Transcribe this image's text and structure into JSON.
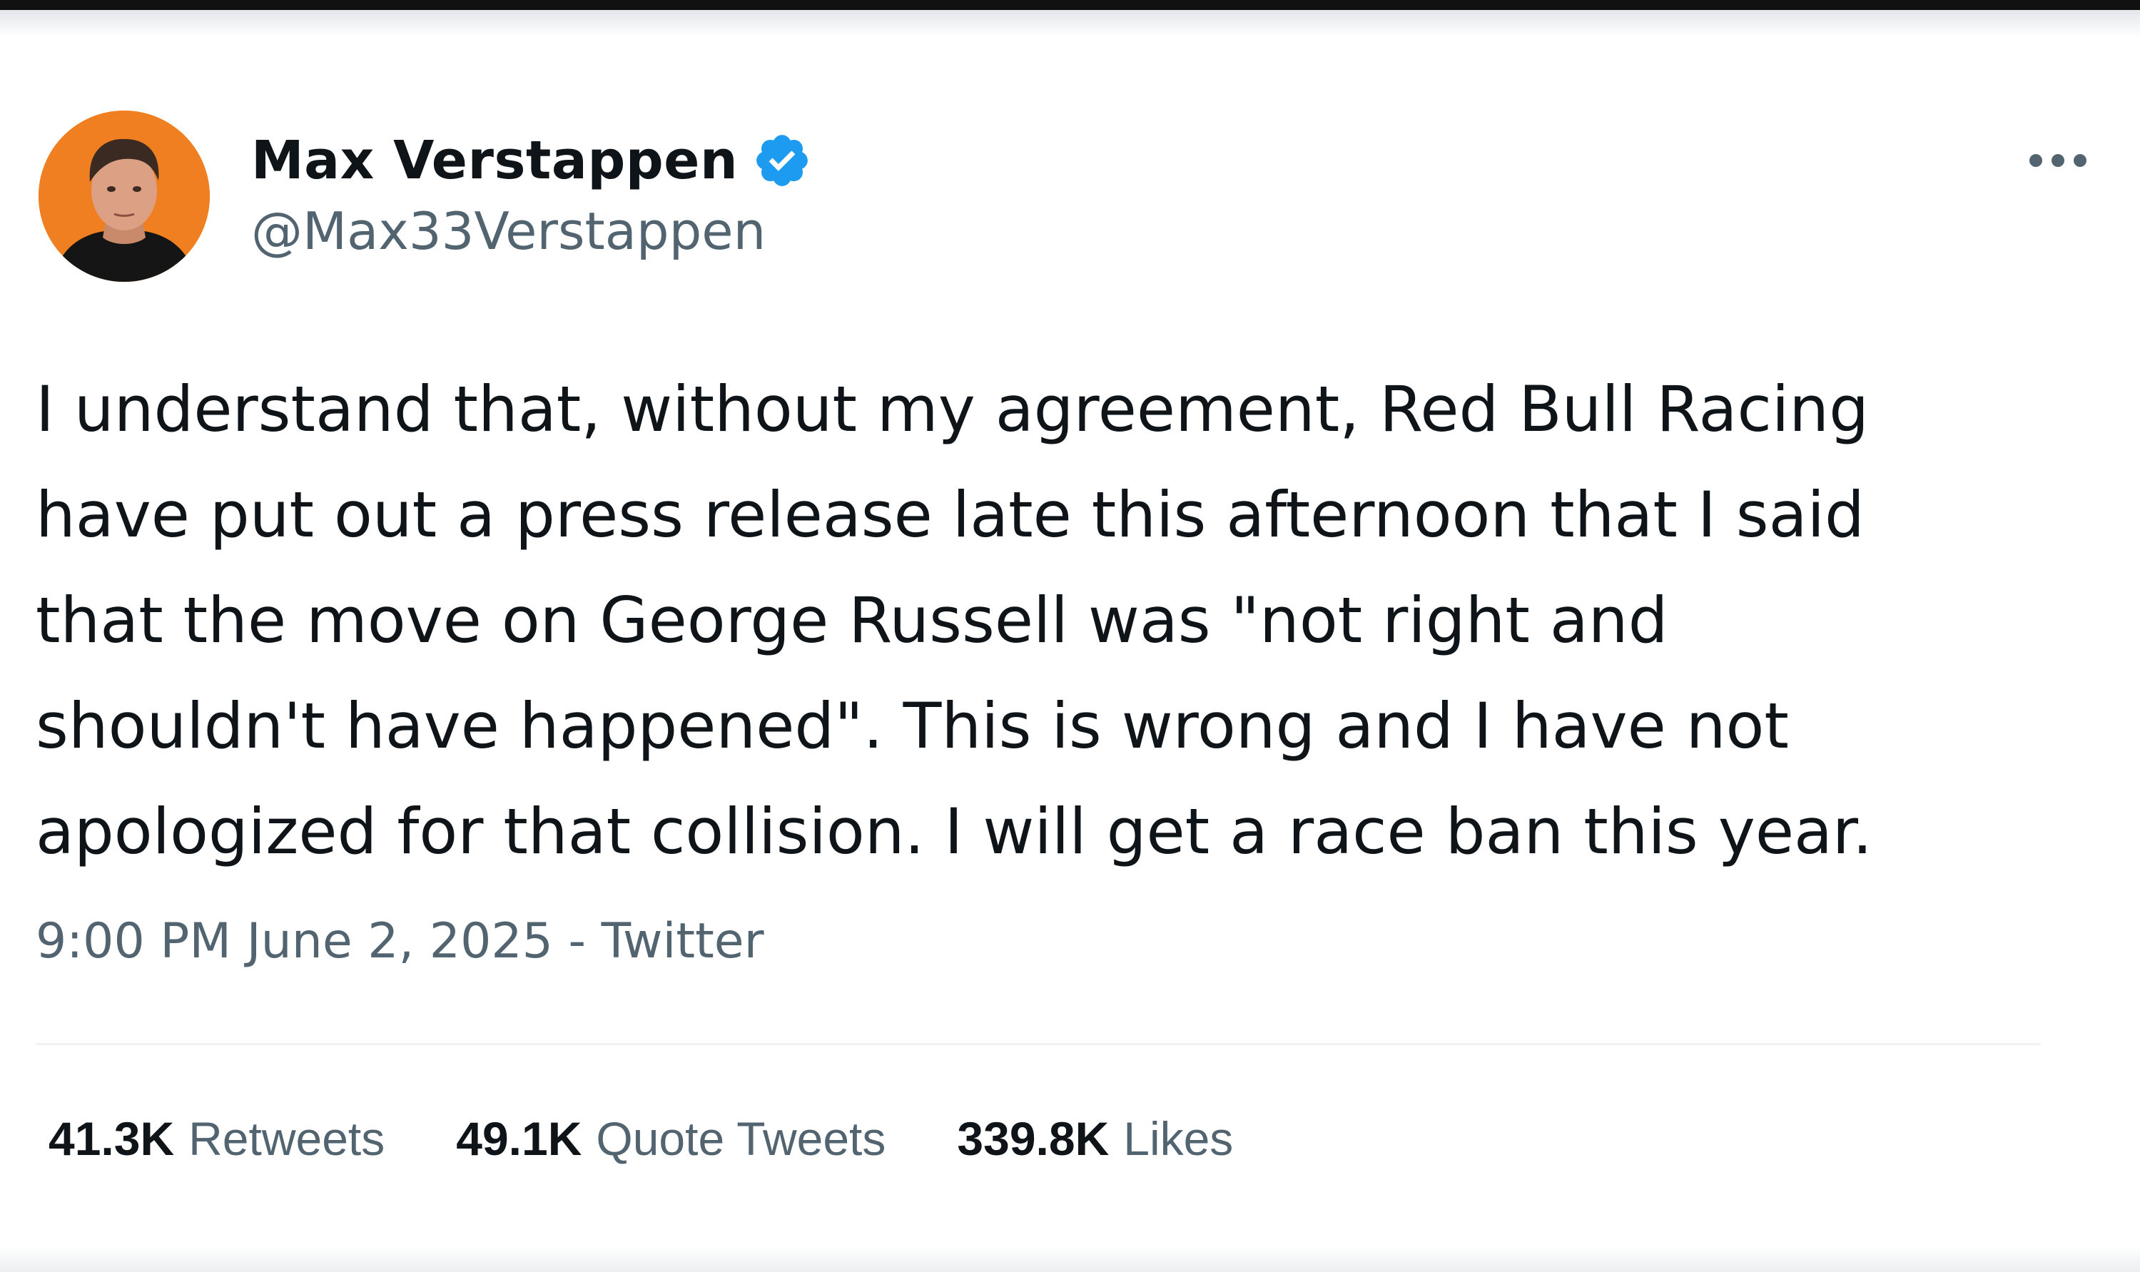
{
  "author": {
    "display_name": "Max Verstappen",
    "handle": "@Max33Verstappen",
    "verified": true,
    "avatar_background": "#f07f22"
  },
  "tweet": {
    "lines": [
      "I understand that, without my agreement, Red Bull Racing",
      "have put out a press release late this afternoon that I said",
      "that the move on George Russell was \"not right and",
      "shouldn't have happened\". This is wrong and I have not",
      "apologized for that collision. I will get a race ban this year."
    ],
    "timestamp": "9:00 PM June 2, 2025",
    "separator": "-",
    "source": "Twitter"
  },
  "stats": [
    {
      "value": "41.3K",
      "label": "Retweets"
    },
    {
      "value": "49.1K",
      "label": "Quote Tweets"
    },
    {
      "value": "339.8K",
      "label": "Likes"
    }
  ],
  "icons": {
    "verified": "verified-badge-icon",
    "more": "more-options-icon"
  },
  "colors": {
    "text_primary": "#0f1419",
    "text_secondary": "#536471",
    "verified_blue": "#1d9bf0"
  }
}
